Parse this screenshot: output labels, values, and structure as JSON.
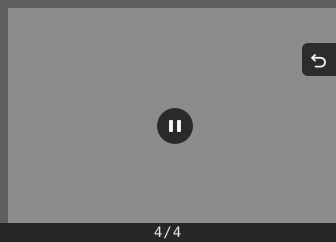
{
  "viewer": {
    "page_indicator": "4/4"
  },
  "controls": {
    "back_icon": "undo-arrow-icon",
    "pause_icon": "pause-icon"
  },
  "colors": {
    "background": "#5e5e5e",
    "viewer": "#8c8c8c",
    "control": "#2a2a2a",
    "bar": "#262626",
    "text": "#e6e6e6"
  }
}
